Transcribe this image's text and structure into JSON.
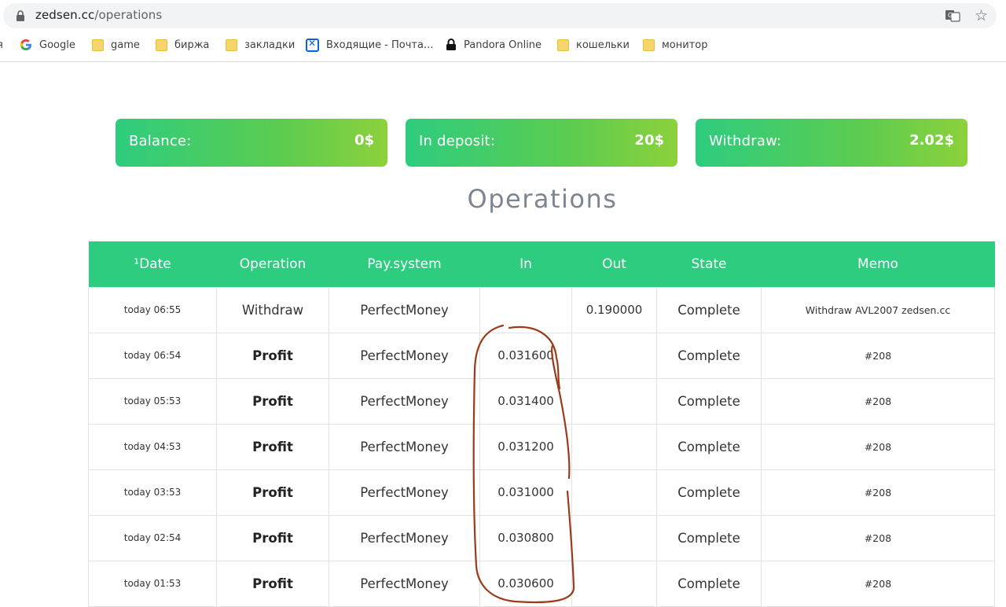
{
  "browser": {
    "url_host": "zedsen.cc",
    "url_path": "/operations",
    "bookmarks": [
      {
        "label": "я",
        "icon": "none"
      },
      {
        "label": "Google",
        "icon": "google-icon"
      },
      {
        "label": "game",
        "icon": "folder-icon"
      },
      {
        "label": "биржа",
        "icon": "folder-icon"
      },
      {
        "label": "закладки",
        "icon": "folder-icon"
      },
      {
        "label": "Входящие - Почта...",
        "icon": "mail-icon"
      },
      {
        "label": "Pandora Online",
        "icon": "lock-icon"
      },
      {
        "label": "кошельки",
        "icon": "folder-icon"
      },
      {
        "label": "монитор",
        "icon": "folder-icon"
      }
    ]
  },
  "stats": {
    "balance_label": "Balance:",
    "balance_value": "0$",
    "deposit_label": "In deposit:",
    "deposit_value": "20$",
    "withdraw_label": "Withdraw:",
    "withdraw_value": "2.02$"
  },
  "page_title": "Operations",
  "table": {
    "headers": [
      "¹Date",
      "Operation",
      "Pay.system",
      "In",
      "Out",
      "State",
      "Memo"
    ],
    "rows": [
      {
        "date": "today 06:55",
        "operation": "Withdraw",
        "pay": "PerfectMoney",
        "in": "",
        "out": "0.190000",
        "state": "Complete",
        "memo": "Withdraw AVL2007 zedsen.cc"
      },
      {
        "date": "today 06:54",
        "operation": "Profit",
        "pay": "PerfectMoney",
        "in": "0.031600",
        "out": "",
        "state": "Complete",
        "memo": "#208"
      },
      {
        "date": "today 05:53",
        "operation": "Profit",
        "pay": "PerfectMoney",
        "in": "0.031400",
        "out": "",
        "state": "Complete",
        "memo": "#208"
      },
      {
        "date": "today 04:53",
        "operation": "Profit",
        "pay": "PerfectMoney",
        "in": "0.031200",
        "out": "",
        "state": "Complete",
        "memo": "#208"
      },
      {
        "date": "today 03:53",
        "operation": "Profit",
        "pay": "PerfectMoney",
        "in": "0.031000",
        "out": "",
        "state": "Complete",
        "memo": "#208"
      },
      {
        "date": "today 02:54",
        "operation": "Profit",
        "pay": "PerfectMoney",
        "in": "0.030800",
        "out": "",
        "state": "Complete",
        "memo": "#208"
      },
      {
        "date": "today 01:53",
        "operation": "Profit",
        "pay": "PerfectMoney",
        "in": "0.030600",
        "out": "",
        "state": "Complete",
        "memo": "#208"
      }
    ]
  },
  "colors": {
    "accent_green": "#2ecc7f",
    "out_red": "#d62828",
    "annotation_brown": "#9b3b1c"
  }
}
